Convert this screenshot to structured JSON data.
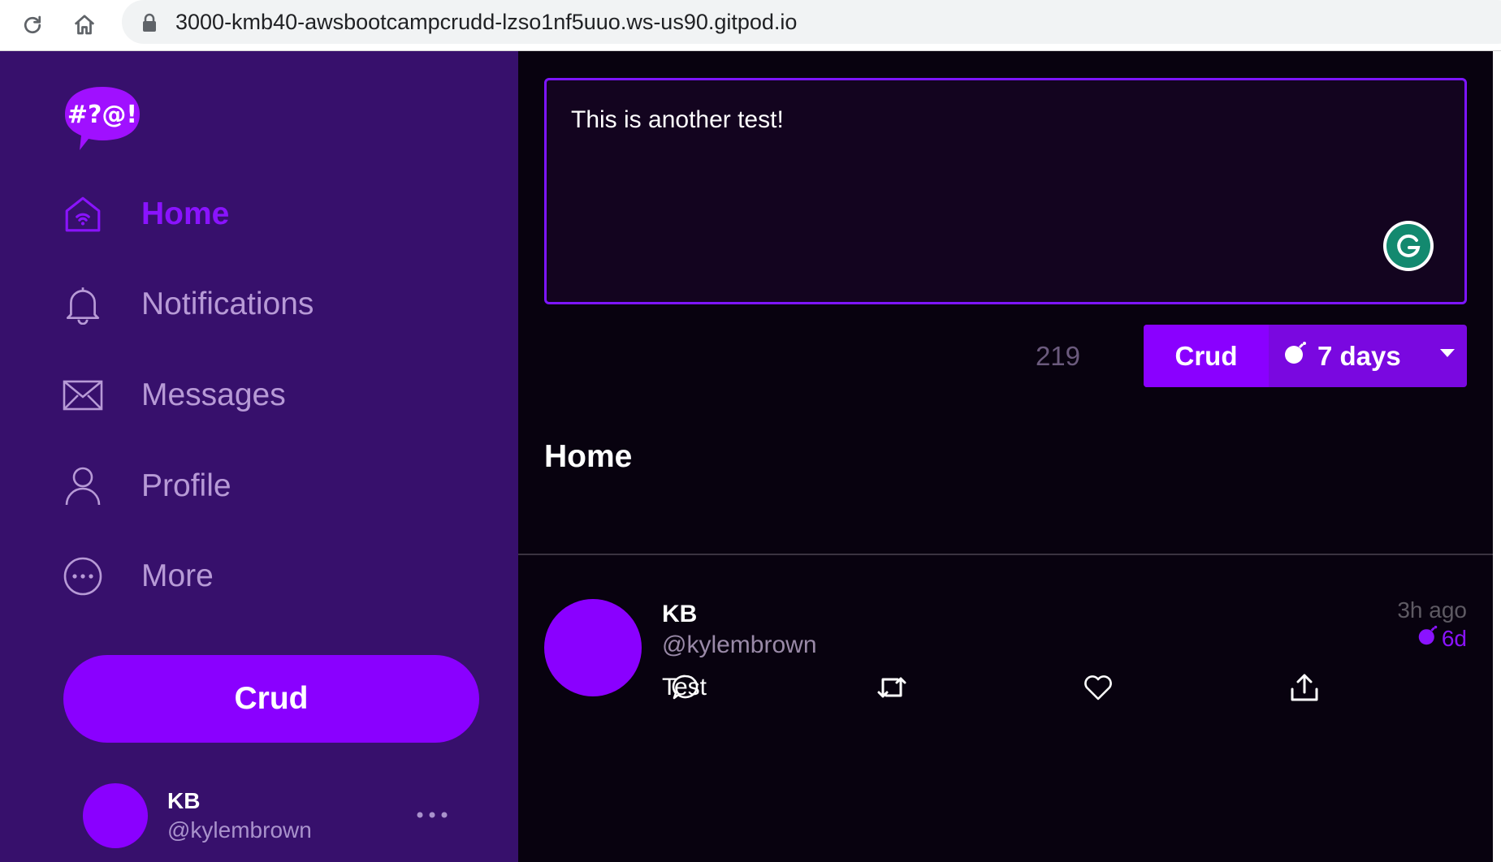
{
  "browser": {
    "url": "3000-kmb40-awsbootcampcrudd-lzso1nf5uuo.ws-us90.gitpod.io"
  },
  "sidebar": {
    "logo_text": "#?@!",
    "items": [
      {
        "label": "Home",
        "icon": "home-icon",
        "active": true
      },
      {
        "label": "Notifications",
        "icon": "bell-icon"
      },
      {
        "label": "Messages",
        "icon": "envelope-icon"
      },
      {
        "label": "Profile",
        "icon": "person-icon"
      },
      {
        "label": "More",
        "icon": "more-circle-icon"
      }
    ],
    "crud_button": "Crud",
    "me": {
      "display_name": "KB",
      "handle": "@kylembrown"
    }
  },
  "compose": {
    "text": "This is another test!",
    "chars_remaining": "219",
    "submit_label": "Crud",
    "ttl_label": "7 days"
  },
  "feed": {
    "title": "Home",
    "posts": [
      {
        "display_name": "KB",
        "handle": "@kylembrown",
        "message": "Test",
        "created": "3h ago",
        "expires": "6d"
      }
    ]
  },
  "colors": {
    "sidebar_bg": "#37106c",
    "accent": "#8a00ff",
    "main_bg": "#08020f"
  }
}
